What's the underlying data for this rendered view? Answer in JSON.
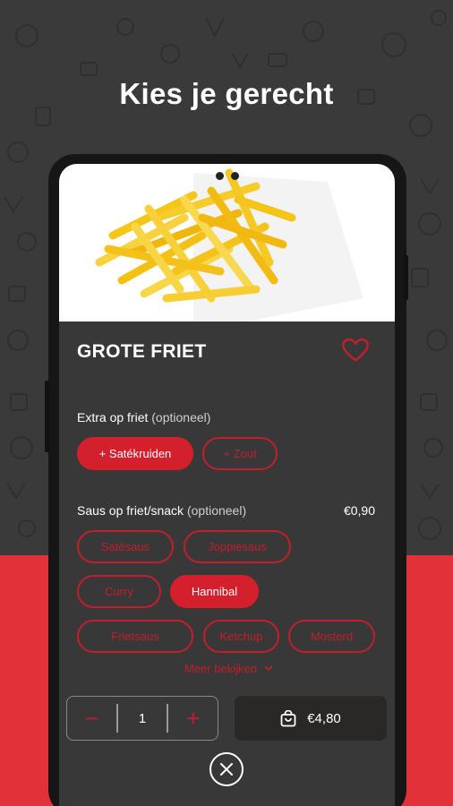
{
  "headline": "Kies je gerecht",
  "product": {
    "title": "GROTE FRIET",
    "image_alt": "fries-image"
  },
  "sections": [
    {
      "label": "Extra op friet",
      "optional_label": "(optioneel)",
      "price": "",
      "options": [
        {
          "label": "+ Satékruiden",
          "selected": true
        },
        {
          "label": "+ Zout",
          "selected": false
        }
      ]
    },
    {
      "label": "Saus op friet/snack",
      "optional_label": "(optioneel)",
      "price": "€0,90",
      "options": [
        {
          "label": "Satésaus",
          "selected": false
        },
        {
          "label": "Joppiesaus",
          "selected": false
        },
        {
          "label": "Curry",
          "selected": false
        },
        {
          "label": "Hannibal",
          "selected": true
        },
        {
          "label": "Frietsaus",
          "selected": false
        },
        {
          "label": "Ketchup",
          "selected": false
        },
        {
          "label": "Mosterd",
          "selected": false
        }
      ]
    }
  ],
  "more_label": "Meer bekijken",
  "quantity": {
    "minus": "−",
    "value": "1",
    "plus": "+"
  },
  "cart": {
    "label": "€4,80",
    "icon": "shopping-bag-icon"
  },
  "close_icon": "close-icon",
  "colors": {
    "accent": "#d41f2d",
    "background_dark": "#3a3a3a",
    "background_red": "#e3313a",
    "card": "#383838"
  }
}
